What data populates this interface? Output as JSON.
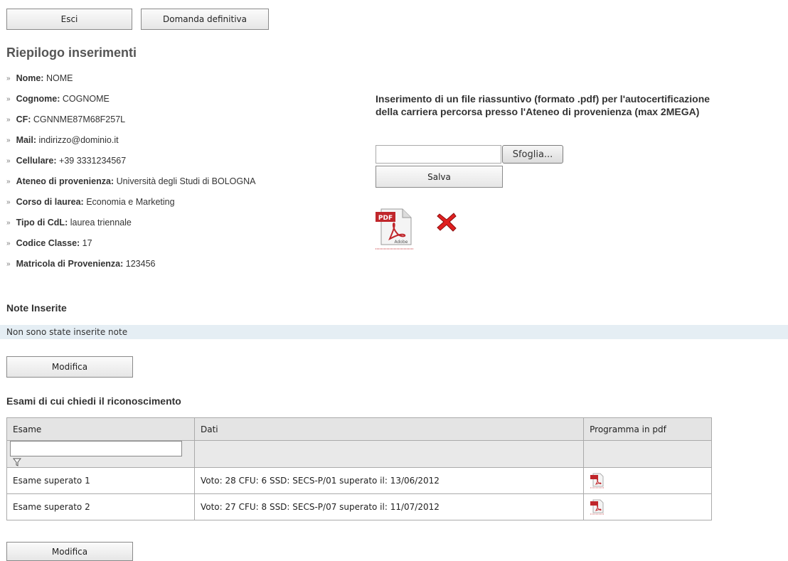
{
  "toolbar": {
    "exit_label": "Esci",
    "final_label": "Domanda definitiva"
  },
  "summary": {
    "title": "Riepilogo inserimenti",
    "items": [
      {
        "label": "Nome:",
        "value": "NOME"
      },
      {
        "label": "Cognome:",
        "value": "COGNOME"
      },
      {
        "label": "CF:",
        "value": "CGNNME87M68F257L"
      },
      {
        "label": "Mail:",
        "value": "indirizzo@dominio.it"
      },
      {
        "label": "Cellulare:",
        "value": "+39 3331234567"
      },
      {
        "label": "Ateneo di provenienza:",
        "value": "Università degli Studi di BOLOGNA"
      },
      {
        "label": "Corso di laurea:",
        "value": " Economia e Marketing"
      },
      {
        "label": "Tipo di CdL:",
        "value": "laurea triennale"
      },
      {
        "label": "Codice Classe:",
        "value": "17"
      },
      {
        "label": "Matricola di Provenienza:",
        "value": "123456"
      }
    ]
  },
  "upload": {
    "title": "Inserimento di un file riassuntivo (formato .pdf) per l'autocertificazione della carriera percorsa presso l'Ateneo di provenienza (max 2MEGA)",
    "file_value": "",
    "browse_label": "Sfoglia...",
    "save_label": "Salva",
    "pdf_icon": "pdf-adobe-icon",
    "delete_icon": "red-x-delete-icon"
  },
  "notes": {
    "title": "Note Inserite",
    "text": "Non sono state inserite note",
    "edit_label": "Modifica"
  },
  "exams": {
    "title": "Esami di cui chiedi il riconoscimento",
    "columns": [
      "Esame",
      "Dati",
      "Programma in pdf"
    ],
    "filter_value": "",
    "rows": [
      {
        "name": "Esame superato 1",
        "data": "Voto: 28 CFU: 6 SSD: SECS-P/01 superato il: 13/06/2012"
      },
      {
        "name": "Esame superato 2",
        "data": "Voto: 27 CFU: 8 SSD: SECS-P/07 superato il: 11/07/2012"
      }
    ],
    "edit_label": "Modifica"
  },
  "colors": {
    "notes_bar": "#e5eef4",
    "table_header": "#e4e4e4",
    "delete_red": "#e02020",
    "pdf_red": "#c0262b"
  }
}
